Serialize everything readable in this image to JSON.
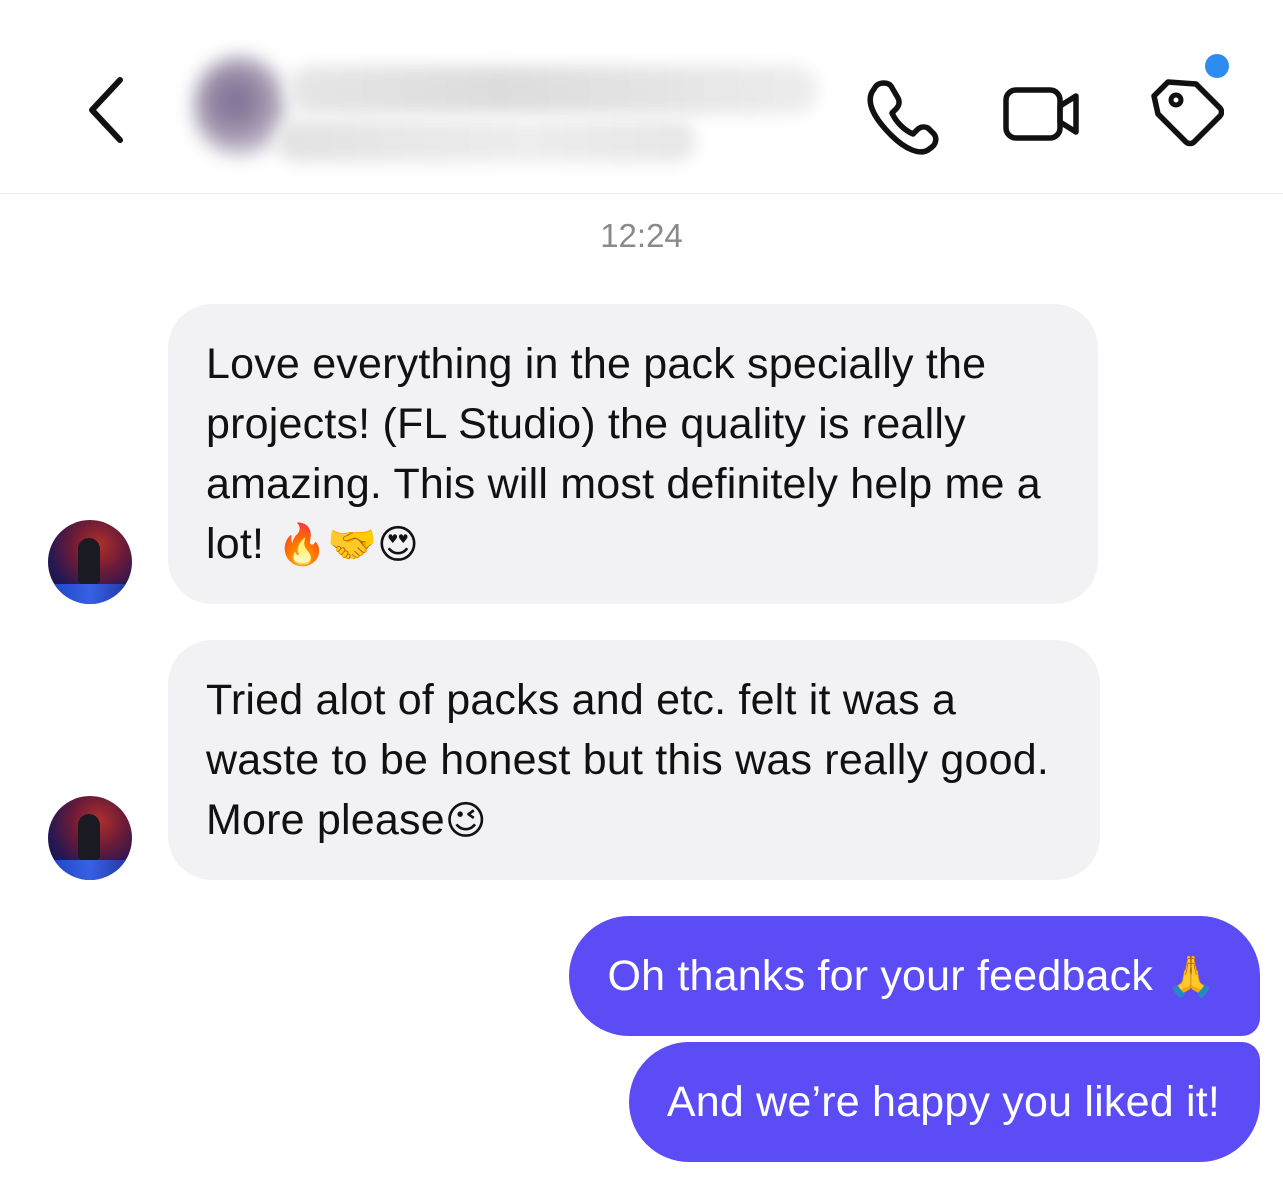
{
  "header": {
    "back_icon": "chevron-left-icon",
    "contact_name": "",
    "icons": [
      "phone-icon",
      "video-camera-icon",
      "tag-icon"
    ],
    "notification_dot_color": "#2e8cf0"
  },
  "conversation": {
    "timestamp": "12:24",
    "incoming": [
      {
        "text": "Love everything in the pack specially the projects! (FL Studio) the quality is really amazing. This will most definitely help me a lot!",
        "emoji": " 🔥🤝😍"
      },
      {
        "text": "Tried alot of packs and etc. felt it was a waste to be honest but this was really good. More please",
        "emoji": "😉"
      }
    ],
    "outgoing": [
      {
        "text": "Oh thanks for your feedback",
        "emoji": " 🙏"
      },
      {
        "text": "And we’re happy you liked it!"
      }
    ]
  },
  "colors": {
    "incoming_bubble": "#f2f2f4",
    "outgoing_bubble": "#5b4cf5",
    "timestamp": "#8a8a8e"
  }
}
